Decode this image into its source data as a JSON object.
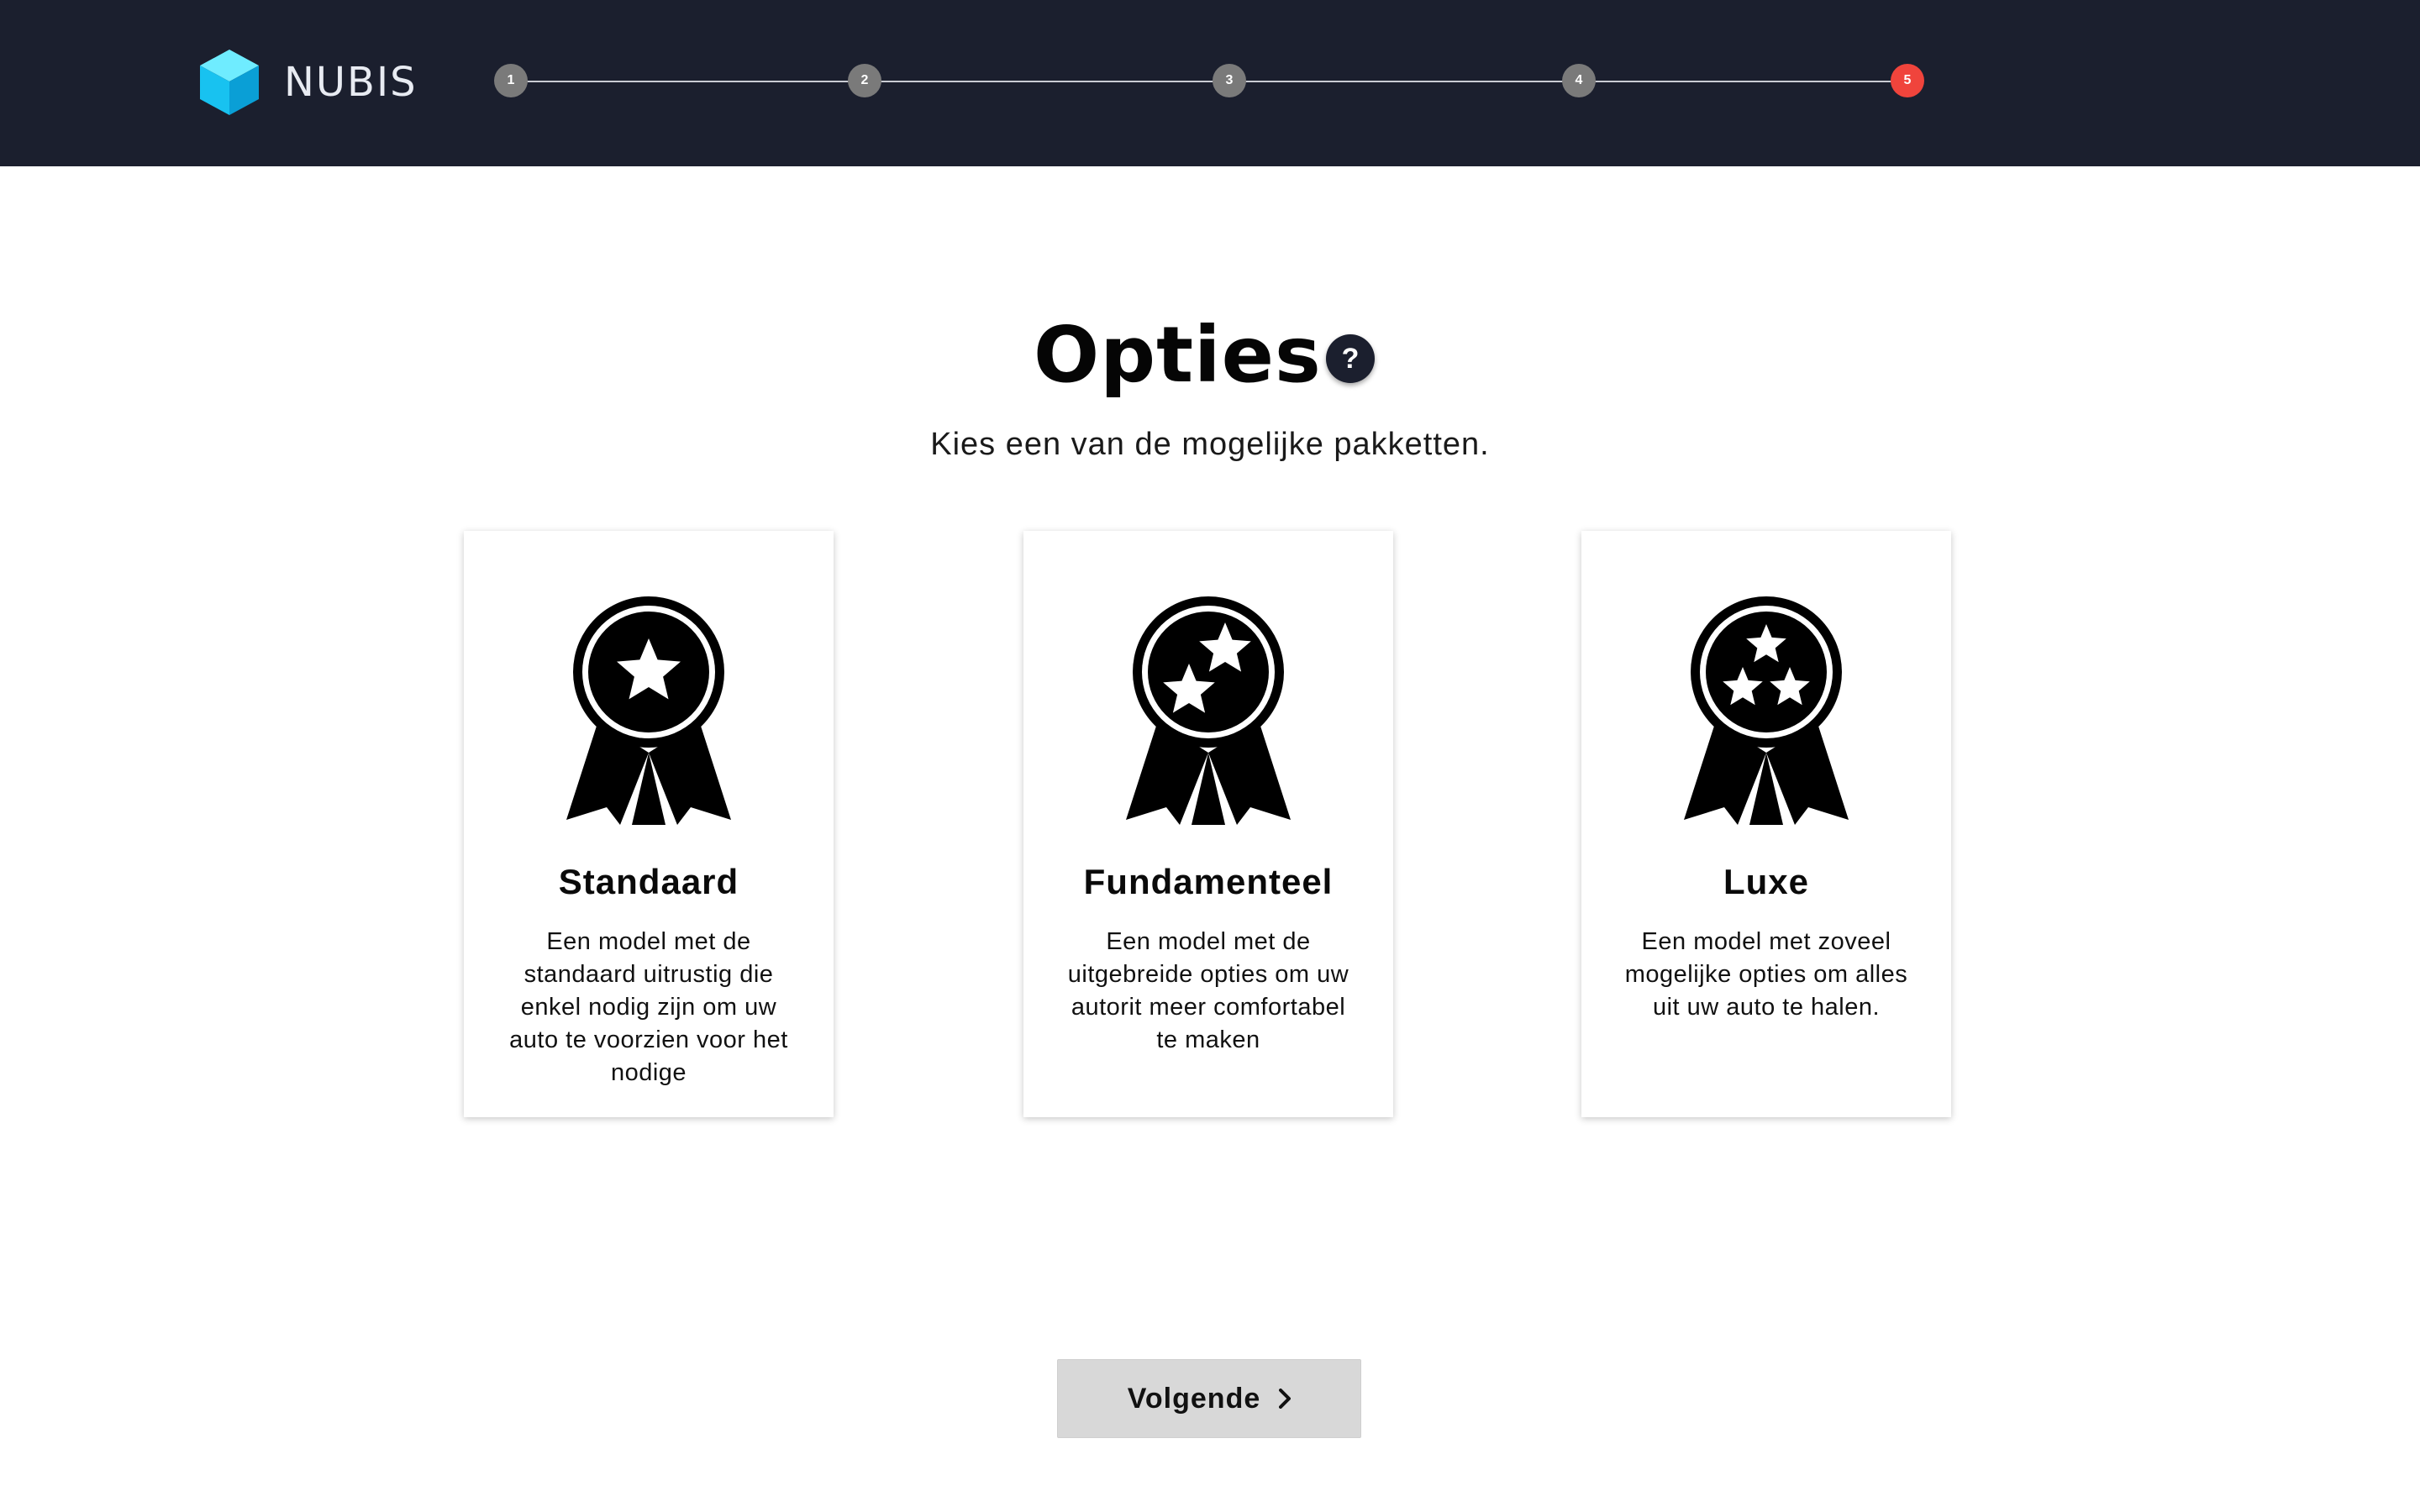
{
  "brand": {
    "name": "NUBIS",
    "logo_icon": "cube-icon",
    "colors": {
      "header_bg": "#1b1f2e",
      "cube_light": "#4fe3ff",
      "cube_mid": "#18c2f0",
      "cube_dark": "#0a9fd6"
    }
  },
  "stepper": {
    "steps": [
      {
        "label": "1",
        "state": "inactive"
      },
      {
        "label": "2",
        "state": "inactive"
      },
      {
        "label": "3",
        "state": "inactive"
      },
      {
        "label": "4",
        "state": "inactive"
      },
      {
        "label": "5",
        "state": "active"
      }
    ],
    "current_step": 5,
    "colors": {
      "inactive": "#7a7a7a",
      "active": "#f0443c"
    }
  },
  "main": {
    "title": "Opties",
    "help_label": "?",
    "help_icon": "question-mark-icon",
    "subtitle": "Kies een van de mogelijke pakketten."
  },
  "packages": [
    {
      "title": "Standaard",
      "description": "Een model met de standaard uitrustig die enkel nodig zijn om uw auto te voorzien  voor het nodige",
      "icon": "award-ribbon-one-star-icon",
      "stars": 1
    },
    {
      "title": "Fundamenteel",
      "description": "Een model met de uitgebreide opties om uw autorit meer comfortabel te maken",
      "icon": "award-ribbon-two-stars-icon",
      "stars": 2
    },
    {
      "title": "Luxe",
      "description": "Een model met zoveel mogelijke opties om alles uit uw auto te halen.",
      "icon": "award-ribbon-three-stars-icon",
      "stars": 3
    }
  ],
  "footer": {
    "next_label": "Volgende",
    "next_icon": "chevron-right-icon"
  }
}
